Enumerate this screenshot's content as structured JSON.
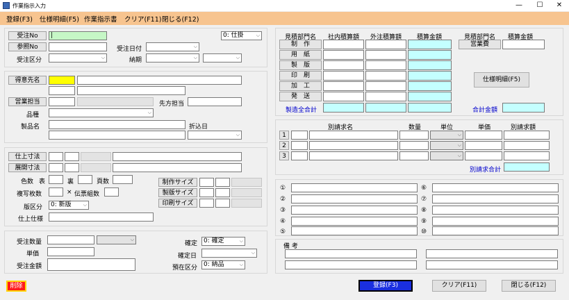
{
  "window": {
    "title": "作業指示入力",
    "min": "—",
    "max": "☐",
    "close": "✕"
  },
  "menu": [
    "登録(F3)",
    "仕様明細(F5)",
    "作業指示書",
    "クリア(F11)",
    "閉じる(F12)"
  ],
  "order": {
    "order_no_label": "受注No",
    "order_no_value": "|",
    "ref_no_label": "参照No",
    "order_type_label": "受注区分",
    "order_date_label": "受注日付",
    "delivery_label": "納期",
    "status_value": "0: 仕掛"
  },
  "customer": {
    "customer_label": "得意先名",
    "sales_label": "営業担当",
    "contact_label": "先方担当",
    "item_label": "品種",
    "product_label": "製品名",
    "fold_date_label": "折込日"
  },
  "spec": {
    "finish_size": "仕上寸法",
    "expand_size": "展開寸法",
    "colors_label": "色数",
    "front_label": "表",
    "back_label": "裏",
    "pages_label": "頁数",
    "copies_label": "複写枚数",
    "times": "×",
    "slip_label": "伝票組数",
    "plate_label": "版区分",
    "plate_value": "0: 新版",
    "finish_spec_label": "仕上仕様",
    "make_size": "制作サイズ",
    "plate_size": "製版サイズ",
    "print_size": "印刷サイズ"
  },
  "qty": {
    "qty_label": "受注数量",
    "price_label": "単価",
    "amount_label": "受注金額",
    "confirm_label": "確定",
    "confirm_value": "0: 確定",
    "confirm_date_label": "確定日",
    "stock_label": "預在区分",
    "stock_value": "0: 納品"
  },
  "estimate": {
    "headers": [
      "見積部門名",
      "社内積算額",
      "外注積算額",
      "積算金額"
    ],
    "rows": [
      "制　作",
      "用　紙",
      "製　版",
      "印　刷",
      "加　工",
      "発　送"
    ],
    "total_label": "製造全合計",
    "right_headers": [
      "見積部門名",
      "積算金額"
    ],
    "sales_cost": "営業費",
    "spec_button": "仕様明細(F5)",
    "grand_total_label": "合計金額"
  },
  "billing": {
    "headers": [
      "別請求名",
      "数量",
      "単位",
      "単価",
      "別請求額"
    ],
    "rows": [
      "1",
      "2",
      "3"
    ],
    "total_label": "別請求合計"
  },
  "notes_marks_left": [
    "①",
    "②",
    "③",
    "④",
    "⑤"
  ],
  "notes_marks_right": [
    "⑥",
    "⑦",
    "⑧",
    "⑨",
    "⑩"
  ],
  "remarks_label": "備 考",
  "bottom": {
    "delete": "削除",
    "register": "登録(F3)",
    "clear": "クリア(F11)",
    "close": "閉じる(F12)"
  }
}
